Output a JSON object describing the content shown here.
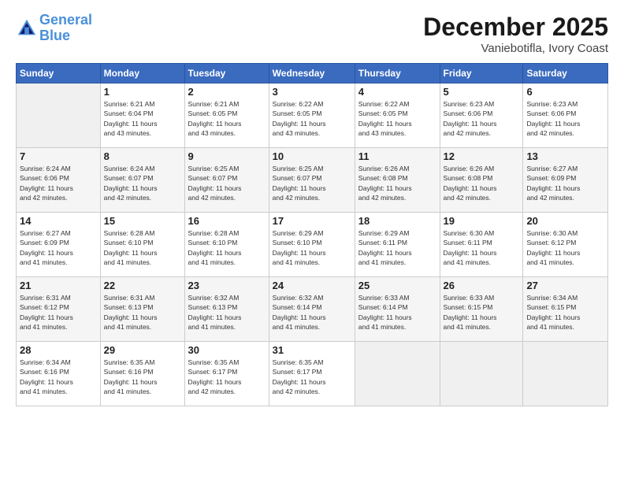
{
  "header": {
    "logo_line1": "General",
    "logo_line2": "Blue",
    "month": "December 2025",
    "location": "Vaniebotifla, Ivory Coast"
  },
  "weekdays": [
    "Sunday",
    "Monday",
    "Tuesday",
    "Wednesday",
    "Thursday",
    "Friday",
    "Saturday"
  ],
  "weeks": [
    [
      {
        "day": "",
        "info": ""
      },
      {
        "day": "1",
        "info": "Sunrise: 6:21 AM\nSunset: 6:04 PM\nDaylight: 11 hours\nand 43 minutes."
      },
      {
        "day": "2",
        "info": "Sunrise: 6:21 AM\nSunset: 6:05 PM\nDaylight: 11 hours\nand 43 minutes."
      },
      {
        "day": "3",
        "info": "Sunrise: 6:22 AM\nSunset: 6:05 PM\nDaylight: 11 hours\nand 43 minutes."
      },
      {
        "day": "4",
        "info": "Sunrise: 6:22 AM\nSunset: 6:05 PM\nDaylight: 11 hours\nand 43 minutes."
      },
      {
        "day": "5",
        "info": "Sunrise: 6:23 AM\nSunset: 6:06 PM\nDaylight: 11 hours\nand 42 minutes."
      },
      {
        "day": "6",
        "info": "Sunrise: 6:23 AM\nSunset: 6:06 PM\nDaylight: 11 hours\nand 42 minutes."
      }
    ],
    [
      {
        "day": "7",
        "info": "Sunrise: 6:24 AM\nSunset: 6:06 PM\nDaylight: 11 hours\nand 42 minutes."
      },
      {
        "day": "8",
        "info": "Sunrise: 6:24 AM\nSunset: 6:07 PM\nDaylight: 11 hours\nand 42 minutes."
      },
      {
        "day": "9",
        "info": "Sunrise: 6:25 AM\nSunset: 6:07 PM\nDaylight: 11 hours\nand 42 minutes."
      },
      {
        "day": "10",
        "info": "Sunrise: 6:25 AM\nSunset: 6:07 PM\nDaylight: 11 hours\nand 42 minutes."
      },
      {
        "day": "11",
        "info": "Sunrise: 6:26 AM\nSunset: 6:08 PM\nDaylight: 11 hours\nand 42 minutes."
      },
      {
        "day": "12",
        "info": "Sunrise: 6:26 AM\nSunset: 6:08 PM\nDaylight: 11 hours\nand 42 minutes."
      },
      {
        "day": "13",
        "info": "Sunrise: 6:27 AM\nSunset: 6:09 PM\nDaylight: 11 hours\nand 42 minutes."
      }
    ],
    [
      {
        "day": "14",
        "info": "Sunrise: 6:27 AM\nSunset: 6:09 PM\nDaylight: 11 hours\nand 41 minutes."
      },
      {
        "day": "15",
        "info": "Sunrise: 6:28 AM\nSunset: 6:10 PM\nDaylight: 11 hours\nand 41 minutes."
      },
      {
        "day": "16",
        "info": "Sunrise: 6:28 AM\nSunset: 6:10 PM\nDaylight: 11 hours\nand 41 minutes."
      },
      {
        "day": "17",
        "info": "Sunrise: 6:29 AM\nSunset: 6:10 PM\nDaylight: 11 hours\nand 41 minutes."
      },
      {
        "day": "18",
        "info": "Sunrise: 6:29 AM\nSunset: 6:11 PM\nDaylight: 11 hours\nand 41 minutes."
      },
      {
        "day": "19",
        "info": "Sunrise: 6:30 AM\nSunset: 6:11 PM\nDaylight: 11 hours\nand 41 minutes."
      },
      {
        "day": "20",
        "info": "Sunrise: 6:30 AM\nSunset: 6:12 PM\nDaylight: 11 hours\nand 41 minutes."
      }
    ],
    [
      {
        "day": "21",
        "info": "Sunrise: 6:31 AM\nSunset: 6:12 PM\nDaylight: 11 hours\nand 41 minutes."
      },
      {
        "day": "22",
        "info": "Sunrise: 6:31 AM\nSunset: 6:13 PM\nDaylight: 11 hours\nand 41 minutes."
      },
      {
        "day": "23",
        "info": "Sunrise: 6:32 AM\nSunset: 6:13 PM\nDaylight: 11 hours\nand 41 minutes."
      },
      {
        "day": "24",
        "info": "Sunrise: 6:32 AM\nSunset: 6:14 PM\nDaylight: 11 hours\nand 41 minutes."
      },
      {
        "day": "25",
        "info": "Sunrise: 6:33 AM\nSunset: 6:14 PM\nDaylight: 11 hours\nand 41 minutes."
      },
      {
        "day": "26",
        "info": "Sunrise: 6:33 AM\nSunset: 6:15 PM\nDaylight: 11 hours\nand 41 minutes."
      },
      {
        "day": "27",
        "info": "Sunrise: 6:34 AM\nSunset: 6:15 PM\nDaylight: 11 hours\nand 41 minutes."
      }
    ],
    [
      {
        "day": "28",
        "info": "Sunrise: 6:34 AM\nSunset: 6:16 PM\nDaylight: 11 hours\nand 41 minutes."
      },
      {
        "day": "29",
        "info": "Sunrise: 6:35 AM\nSunset: 6:16 PM\nDaylight: 11 hours\nand 41 minutes."
      },
      {
        "day": "30",
        "info": "Sunrise: 6:35 AM\nSunset: 6:17 PM\nDaylight: 11 hours\nand 42 minutes."
      },
      {
        "day": "31",
        "info": "Sunrise: 6:35 AM\nSunset: 6:17 PM\nDaylight: 11 hours\nand 42 minutes."
      },
      {
        "day": "",
        "info": ""
      },
      {
        "day": "",
        "info": ""
      },
      {
        "day": "",
        "info": ""
      }
    ]
  ]
}
